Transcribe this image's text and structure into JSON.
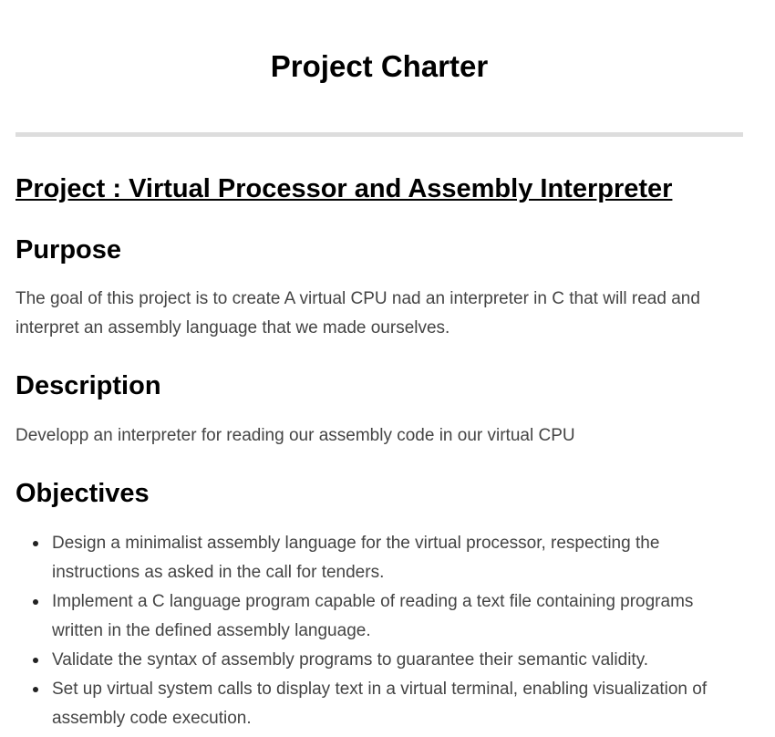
{
  "document": {
    "title": "Project Charter",
    "project_heading": "Project : Virtual Processor and Assembly Interpreter",
    "sections": {
      "purpose": {
        "heading": "Purpose",
        "text": "The goal of this project is to create A virtual CPU nad an interpreter in C that will read and interpret an assembly language that we made ourselves."
      },
      "description": {
        "heading": "Description",
        "text": "Developp an interpreter for reading our assembly code in our virtual CPU"
      },
      "objectives": {
        "heading": "Objectives",
        "items": [
          "Design a minimalist assembly language for the virtual processor, respecting the instructions as asked in the call for tenders.",
          "Implement a C language program capable of reading a text file containing programs written in the defined assembly language.",
          "Validate the syntax of assembly programs to guarantee their semantic validity.",
          "Set up virtual system calls to display text in a virtual terminal, enabling visualization of assembly code execution."
        ]
      }
    }
  }
}
